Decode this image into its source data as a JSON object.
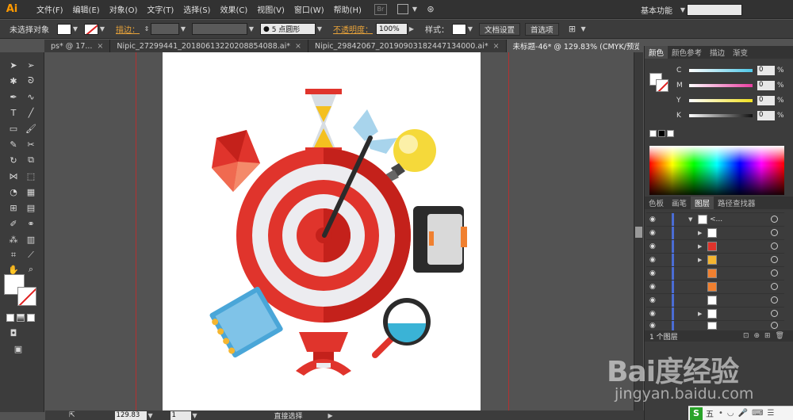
{
  "app": {
    "logo": "Ai"
  },
  "menu": {
    "items": [
      "文件(F)",
      "编辑(E)",
      "对象(O)",
      "文字(T)",
      "选择(S)",
      "效果(C)",
      "视图(V)",
      "窗口(W)",
      "帮助(H)"
    ],
    "br_badge": "Br",
    "workspace": "基本功能"
  },
  "control": {
    "no_selection": "未选择对象",
    "stroke_label": "描边：",
    "brush": "5 点圆形",
    "opacity_label": "不透明度：",
    "opacity_value": "100%",
    "style_label": "样式：",
    "doc_settings": "文档设置",
    "preferences": "首选项"
  },
  "tabs": [
    {
      "label": "ps* @ 17..."
    },
    {
      "label": "Nipic_27299441_20180613220208854088.ai*"
    },
    {
      "label": "Nipic_29842067_20190903182447134000.ai*"
    },
    {
      "label": "未标题-46* @ 129.83% (CMYK/预览)"
    }
  ],
  "status": {
    "zoom": "129.83",
    "page": "1",
    "tool": "直接选择"
  },
  "color_panel": {
    "tabs": [
      "颜色",
      "颜色参考",
      "描边",
      "渐变"
    ],
    "channels": [
      {
        "label": "C",
        "value": "0",
        "color": "#4ec8e8"
      },
      {
        "label": "M",
        "value": "0",
        "color": "#e83ea0"
      },
      {
        "label": "Y",
        "value": "0",
        "color": "#f0e020"
      },
      {
        "label": "K",
        "value": "0",
        "color": "#bbbbbb"
      }
    ],
    "unit": "%"
  },
  "layers_panel": {
    "tabs": [
      "色板",
      "画笔",
      "图层",
      "路径查找器"
    ],
    "first_layer": "<...",
    "footer": "1 个图层"
  },
  "watermark": {
    "main": "Bai度经验",
    "sub": "jingyan.baidu.com"
  },
  "ime": {
    "label": "五"
  },
  "artwork": {
    "colors": {
      "target_red": "#e0342c",
      "target_dark": "#c4211b",
      "ring_white": "#ececf0",
      "bulb": "#f5d93a",
      "magnifier": "#3ab3d6",
      "notebook": "#4aa6d8",
      "ribbon": "#f4b530"
    }
  }
}
